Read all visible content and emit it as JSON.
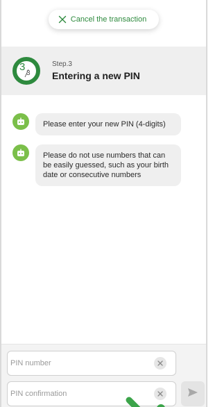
{
  "cancel": {
    "label": "Cancel the transaction",
    "icon": "close-icon"
  },
  "step": {
    "current": "3",
    "total": "3",
    "label": "Step.3",
    "title": "Entering a new PIN",
    "progress": 1.0,
    "accent_color": "#2e8a3e"
  },
  "messages": [
    {
      "icon": "robot-icon",
      "text": "Please enter your new PIN (4-digits)"
    },
    {
      "icon": "robot-icon",
      "text": "Please do not use numbers that can be easily guessed, such as your birth date or consecutive numbers"
    }
  ],
  "inputs": {
    "pin": {
      "value": "",
      "placeholder": "PIN number"
    },
    "confirm": {
      "value": "",
      "placeholder": "PIN confirmation"
    }
  },
  "colors": {
    "accent": "#2e8a3e",
    "bot_avatar": "#7bbf4a",
    "header_bg": "#efefef",
    "bubble_bg": "#efefef"
  }
}
